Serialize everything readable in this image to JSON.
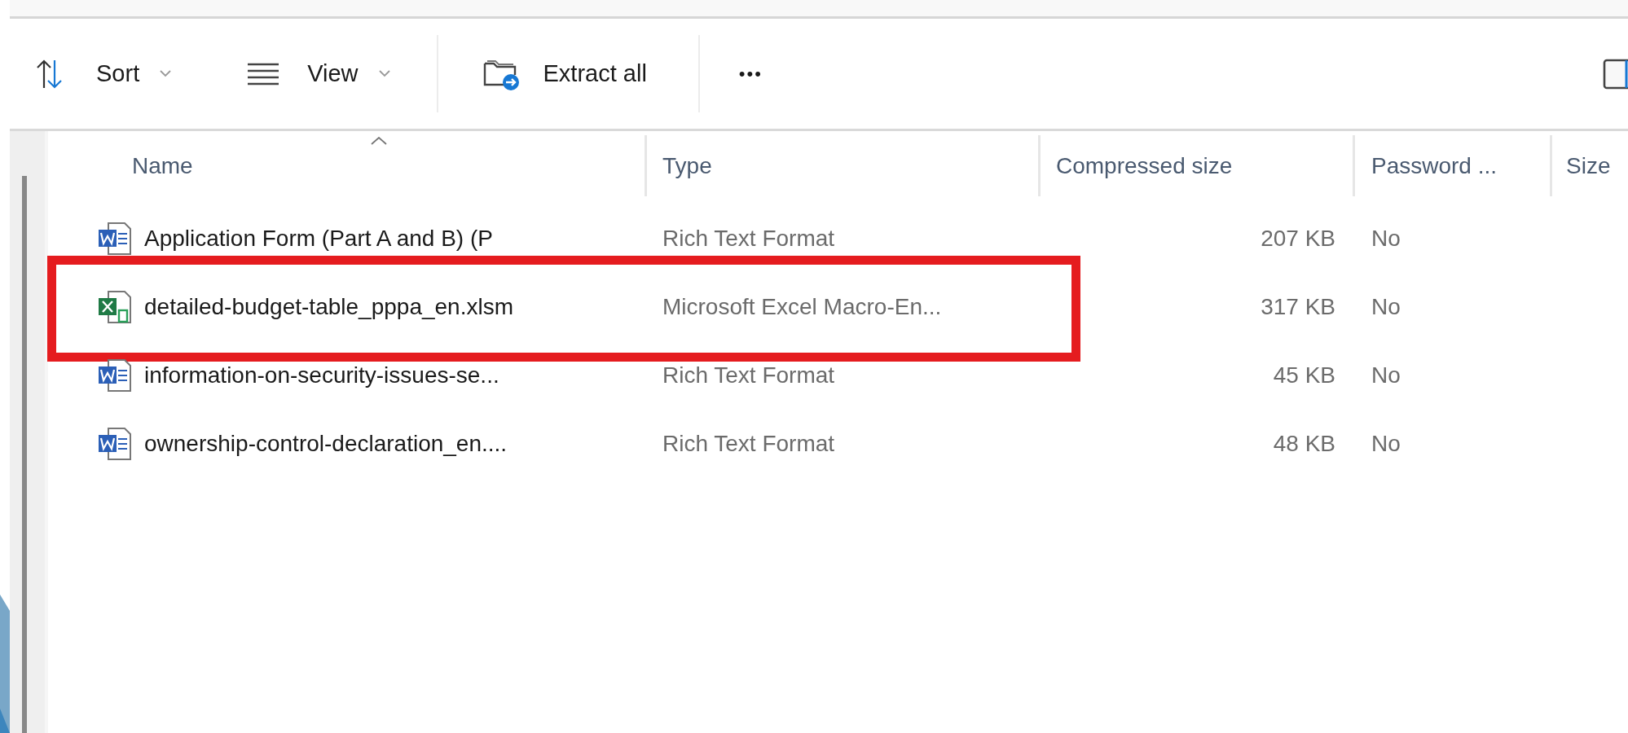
{
  "toolbar": {
    "items": [
      {
        "kind": "sort",
        "label": "Sort",
        "dropdown": true
      },
      {
        "kind": "view",
        "label": "View",
        "dropdown": true
      },
      {
        "kind": "extract",
        "label": "Extract all",
        "dropdown": false
      },
      {
        "kind": "more",
        "label": "•••",
        "dropdown": false
      }
    ]
  },
  "table": {
    "columns": [
      {
        "label": "Name",
        "sorted": true
      },
      {
        "label": "Type",
        "sorted": false
      },
      {
        "label": "Compressed size",
        "sorted": false
      },
      {
        "label": "Password ...",
        "sorted": false
      },
      {
        "label": "Size",
        "sorted": false
      }
    ],
    "rows": [
      {
        "kind": "word",
        "name": "Application Form (Part A and B) (P",
        "type": "Rich Text Format",
        "compressed_size": "207 KB",
        "password": "No",
        "highlighted": false
      },
      {
        "kind": "excel",
        "name": "detailed-budget-table_pppa_en.xlsm",
        "type": "Microsoft Excel Macro-En...",
        "compressed_size": "317 KB",
        "password": "No",
        "highlighted": true
      },
      {
        "kind": "word",
        "name": "information-on-security-issues-se...",
        "type": "Rich Text Format",
        "compressed_size": "45 KB",
        "password": "No",
        "highlighted": false
      },
      {
        "kind": "word",
        "name": "ownership-control-declaration_en....",
        "type": "Rich Text Format",
        "compressed_size": "48 KB",
        "password": "No",
        "highlighted": false
      }
    ]
  }
}
